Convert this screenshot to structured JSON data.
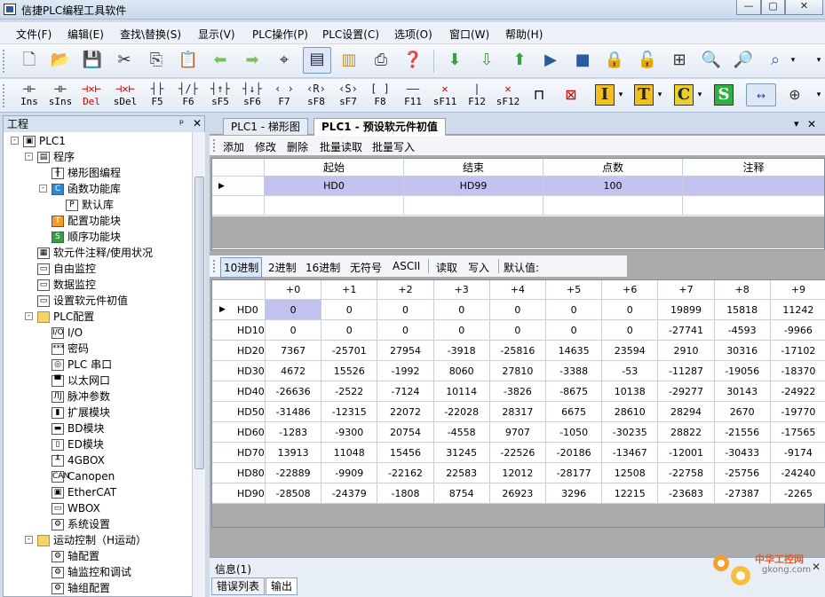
{
  "title": "信捷PLC编程工具软件",
  "window_buttons": [
    "—",
    "▢",
    "✕"
  ],
  "menu": [
    "文件(F)",
    "编辑(E)",
    "查找\\替换(S)",
    "显示(V)",
    "PLC操作(P)",
    "PLC设置(C)",
    "选项(O)",
    "窗口(W)",
    "帮助(H)"
  ],
  "ladder_tools": [
    {
      "sym": "⊣⊢",
      "label": "Ins"
    },
    {
      "sym": "⊣⊢",
      "label": "sIns"
    },
    {
      "sym": "⊣✕⊢",
      "label": "Del"
    },
    {
      "sym": "⊣✕⊢",
      "label": "sDel"
    },
    {
      "sym": "┤├",
      "label": "F5"
    },
    {
      "sym": "┤/├",
      "label": "F6"
    },
    {
      "sym": "┤↑├",
      "label": "sF5"
    },
    {
      "sym": "┤↓├",
      "label": "sF6"
    },
    {
      "sym": "‹ ›",
      "label": "F7"
    },
    {
      "sym": "‹R›",
      "label": "sF8"
    },
    {
      "sym": "‹S›",
      "label": "sF7"
    },
    {
      "sym": "[ ]",
      "label": "F8"
    },
    {
      "sym": "——",
      "label": "F11"
    },
    {
      "sym": "✕",
      "label": "sF11"
    },
    {
      "sym": "|",
      "label": "F12"
    },
    {
      "sym": "✕",
      "label": "sF12"
    }
  ],
  "tree_title": "工程",
  "tree_header_buttons": [
    "ᵖ",
    "✕"
  ],
  "tree": [
    {
      "label": "PLC1",
      "level": 0,
      "icon": "plc-icon",
      "glyph": "▣",
      "exp": "-"
    },
    {
      "label": "程序",
      "level": 1,
      "icon": "program-icon",
      "glyph": "▤",
      "exp": "-"
    },
    {
      "label": "梯形图编程",
      "level": 2,
      "icon": "ladder-icon",
      "glyph": "╫",
      "exp": ""
    },
    {
      "label": "函数功能库",
      "level": 2,
      "icon": "c-function-icon",
      "glyph": "C",
      "exp": "-"
    },
    {
      "label": "默认库",
      "level": 3,
      "icon": "library-icon",
      "glyph": "P",
      "exp": ""
    },
    {
      "label": "配置功能块",
      "level": 2,
      "icon": "t-block-icon",
      "glyph": "T",
      "exp": ""
    },
    {
      "label": "顺序功能块",
      "level": 2,
      "icon": "s-block-icon",
      "glyph": "S",
      "exp": ""
    },
    {
      "label": "软元件注释/使用状况",
      "level": 1,
      "icon": "comment-icon",
      "glyph": "▦",
      "exp": ""
    },
    {
      "label": "自由监控",
      "level": 1,
      "icon": "monitor-icon",
      "glyph": "▭",
      "exp": ""
    },
    {
      "label": "数据监控",
      "level": 1,
      "icon": "data-monitor-icon",
      "glyph": "▭",
      "exp": ""
    },
    {
      "label": "设置软元件初值",
      "level": 1,
      "icon": "init-value-icon",
      "glyph": "▭",
      "exp": ""
    },
    {
      "label": "PLC配置",
      "level": 1,
      "icon": "folder-icon",
      "glyph": "",
      "exp": "-"
    },
    {
      "label": "I/O",
      "level": 2,
      "icon": "io-icon",
      "glyph": "I/O",
      "exp": ""
    },
    {
      "label": "密码",
      "level": 2,
      "icon": "password-icon",
      "glyph": "***",
      "exp": ""
    },
    {
      "label": "PLC 串口",
      "level": 2,
      "icon": "serial-port-icon",
      "glyph": "◎",
      "exp": ""
    },
    {
      "label": "以太网口",
      "level": 2,
      "icon": "ethernet-icon",
      "glyph": "▀",
      "exp": ""
    },
    {
      "label": "脉冲参数",
      "level": 2,
      "icon": "pulse-icon",
      "glyph": "ЛJ",
      "exp": ""
    },
    {
      "label": "扩展模块",
      "level": 2,
      "icon": "expansion-module-icon",
      "glyph": "▮",
      "exp": ""
    },
    {
      "label": "BD模块",
      "level": 2,
      "icon": "bd-module-icon",
      "glyph": "▬",
      "exp": ""
    },
    {
      "label": "ED模块",
      "level": 2,
      "icon": "ed-module-icon",
      "glyph": "▯",
      "exp": ""
    },
    {
      "label": "4GBOX",
      "level": 2,
      "icon": "4gbox-icon",
      "glyph": "╨",
      "exp": ""
    },
    {
      "label": "Canopen",
      "level": 2,
      "icon": "canopen-icon",
      "glyph": "CAN",
      "exp": ""
    },
    {
      "label": "EtherCAT",
      "level": 2,
      "icon": "ethercat-icon",
      "glyph": "▣",
      "exp": ""
    },
    {
      "label": "WBOX",
      "level": 2,
      "icon": "wbox-icon",
      "glyph": "▭",
      "exp": ""
    },
    {
      "label": "系统设置",
      "level": 2,
      "icon": "system-settings-icon",
      "glyph": "⚙",
      "exp": ""
    },
    {
      "label": "运动控制（H运动）",
      "level": 1,
      "icon": "folder-icon",
      "glyph": "",
      "exp": "-"
    },
    {
      "label": "轴配置",
      "level": 2,
      "icon": "axis-config-icon",
      "glyph": "⚙",
      "exp": ""
    },
    {
      "label": "轴监控和调试",
      "level": 2,
      "icon": "axis-monitor-icon",
      "glyph": "⚙",
      "exp": ""
    },
    {
      "label": "轴组配置",
      "level": 2,
      "icon": "axis-group-icon",
      "glyph": "⚙",
      "exp": ""
    }
  ],
  "tabs": [
    {
      "label": "PLC1 - 梯形图",
      "active": false
    },
    {
      "label": "PLC1 - 预设软元件初值",
      "active": true
    }
  ],
  "tab_controls": [
    "▾",
    "✕"
  ],
  "actions": [
    "添加",
    "修改",
    "删除",
    "批量读取",
    "批量写入"
  ],
  "range_table": {
    "columns": [
      "起始",
      "结束",
      "点数",
      "注释"
    ],
    "rows": [
      {
        "start": "HD0",
        "end": "HD99",
        "count": "100",
        "comment": ""
      }
    ]
  },
  "value_toolbar": {
    "formats": [
      "10进制",
      "2进制",
      "16进制",
      "无符号",
      "ASCII"
    ],
    "active_format": "10进制",
    "ops": [
      "读取",
      "写入"
    ],
    "default_label": "默认值:"
  },
  "value_table": {
    "columns": [
      "+0",
      "+1",
      "+2",
      "+3",
      "+4",
      "+5",
      "+6",
      "+7",
      "+8",
      "+9"
    ],
    "rows": [
      {
        "label": "HD0",
        "values": [
          "0",
          "0",
          "0",
          "0",
          "0",
          "0",
          "0",
          "19899",
          "15818",
          "11242"
        ]
      },
      {
        "label": "HD10",
        "values": [
          "0",
          "0",
          "0",
          "0",
          "0",
          "0",
          "0",
          "-27741",
          "-4593",
          "-9966"
        ]
      },
      {
        "label": "HD20",
        "values": [
          "7367",
          "-25701",
          "27954",
          "-3918",
          "-25816",
          "14635",
          "23594",
          "2910",
          "30316",
          "-17102"
        ]
      },
      {
        "label": "HD30",
        "values": [
          "4672",
          "15526",
          "-1992",
          "8060",
          "27810",
          "-3388",
          "-53",
          "-11287",
          "-19056",
          "-18370"
        ]
      },
      {
        "label": "HD40",
        "values": [
          "-26636",
          "-2522",
          "-7124",
          "10114",
          "-3826",
          "-8675",
          "10138",
          "-29277",
          "30143",
          "-24922"
        ]
      },
      {
        "label": "HD50",
        "values": [
          "-31486",
          "-12315",
          "22072",
          "-22028",
          "28317",
          "6675",
          "28610",
          "28294",
          "2670",
          "-19770"
        ]
      },
      {
        "label": "HD60",
        "values": [
          "-1283",
          "-9300",
          "20754",
          "-4558",
          "9707",
          "-1050",
          "-30235",
          "28822",
          "-21556",
          "-17565"
        ]
      },
      {
        "label": "HD70",
        "values": [
          "13913",
          "11048",
          "15456",
          "31245",
          "-22526",
          "-20186",
          "-13467",
          "-12001",
          "-30433",
          "-9174"
        ]
      },
      {
        "label": "HD80",
        "values": [
          "-22889",
          "-9909",
          "-22162",
          "22583",
          "12012",
          "-28177",
          "12508",
          "-22758",
          "-25756",
          "-24240"
        ]
      },
      {
        "label": "HD90",
        "values": [
          "-28508",
          "-24379",
          "-1808",
          "8754",
          "26923",
          "3296",
          "12215",
          "-23683",
          "-27387",
          "-2265"
        ]
      }
    ]
  },
  "info": {
    "title": "信息(1)",
    "tabs": [
      "错误列表",
      "输出"
    ],
    "active_tab": "输出"
  },
  "watermark": {
    "brand": "中华工控网",
    "url": "gkong.com"
  },
  "colors": {
    "selection": "#c3c3f0",
    "frame": "#cfdbea"
  }
}
